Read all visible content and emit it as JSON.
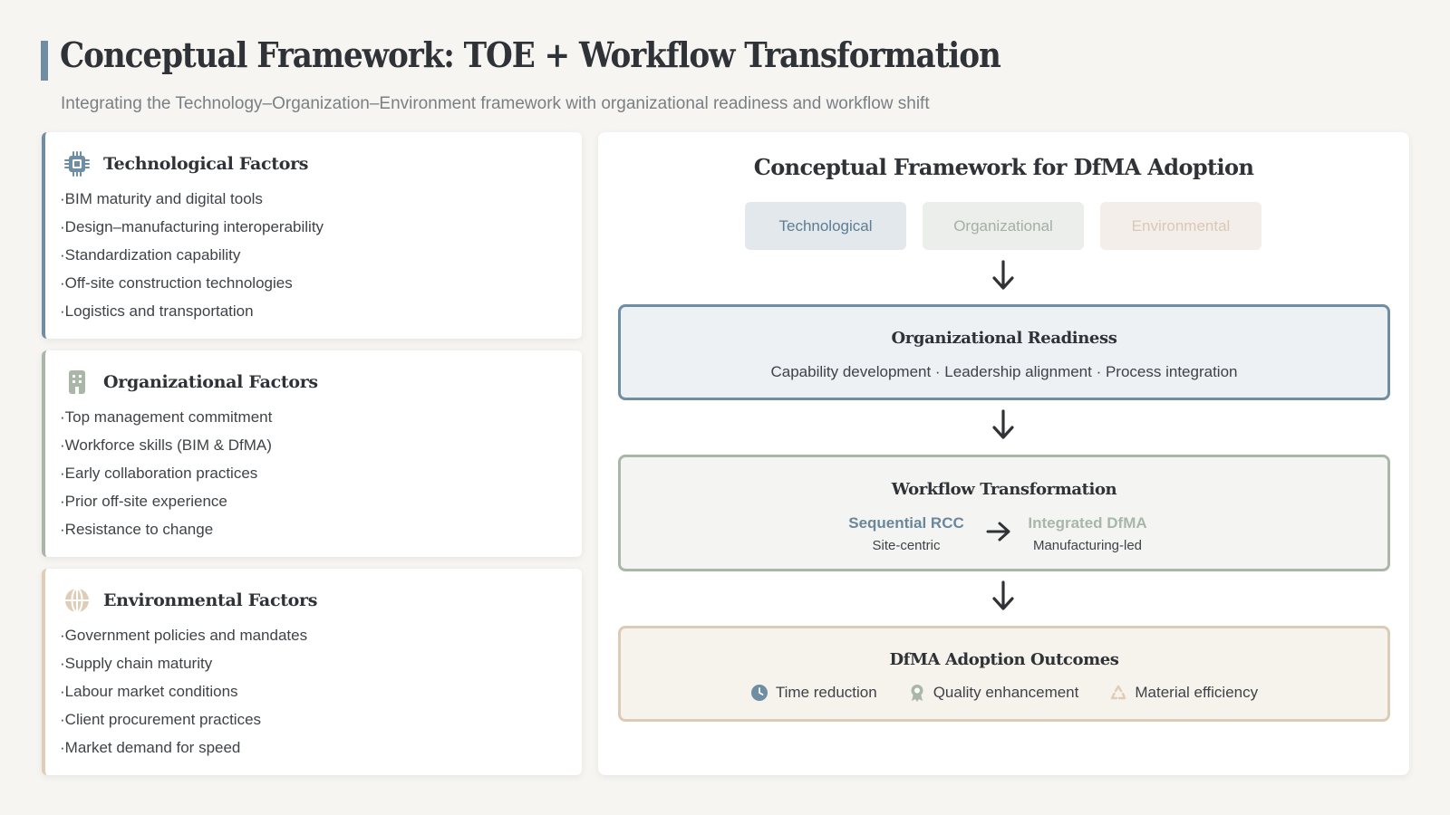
{
  "header": {
    "title": "Conceptual Framework: TOE + Workflow Transformation",
    "subtitle": "Integrating the Technology–Organization–Environment framework with organizational readiness and workflow shift"
  },
  "factors": {
    "technological": {
      "title": "Technological Factors",
      "icon": "chip-icon",
      "items": [
        "BIM maturity and digital tools",
        "Design–manufacturing interoperability",
        "Standardization capability",
        "Off-site construction technologies",
        "Logistics and transportation"
      ]
    },
    "organizational": {
      "title": "Organizational Factors",
      "icon": "building-icon",
      "items": [
        "Top management commitment",
        "Workforce skills (BIM & DfMA)",
        "Early collaboration practices",
        "Prior off-site experience",
        "Resistance to change"
      ]
    },
    "environmental": {
      "title": "Environmental Factors",
      "icon": "globe-icon",
      "items": [
        "Government policies and mandates",
        "Supply chain maturity",
        "Labour market conditions",
        "Client procurement practices",
        "Market demand for speed"
      ]
    }
  },
  "framework": {
    "title": "Conceptual Framework for DfMA Adoption",
    "pills": [
      "Technological",
      "Organizational",
      "Environmental"
    ],
    "readiness": {
      "title": "Organizational Readiness",
      "description": "Capability development · Leadership alignment · Process integration"
    },
    "workflow": {
      "title": "Workflow Transformation",
      "from_label": "Sequential RCC",
      "from_sub": "Site-centric",
      "to_label": "Integrated DfMA",
      "to_sub": "Manufacturing-led"
    },
    "outcomes": {
      "title": "DfMA Adoption Outcomes",
      "items": [
        {
          "label": "Time reduction",
          "icon": "clock-icon"
        },
        {
          "label": "Quality enhancement",
          "icon": "award-icon"
        },
        {
          "label": "Material efficiency",
          "icon": "recycle-icon"
        }
      ]
    }
  },
  "colors": {
    "technological": "#6f8ea3",
    "organizational": "#a9b6a8",
    "environmental": "#dccbb6",
    "background": "#f6f5f2"
  }
}
